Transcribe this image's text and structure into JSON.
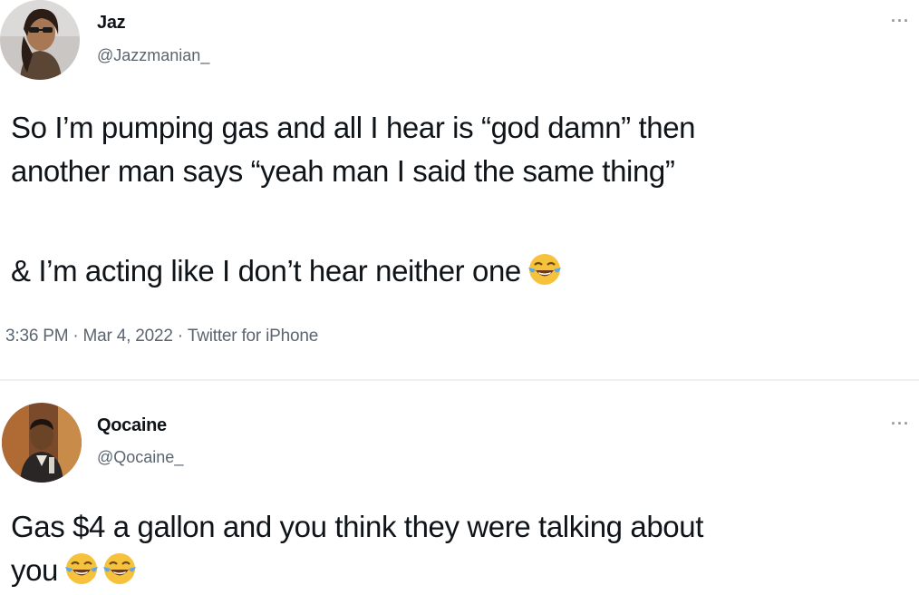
{
  "tweets": [
    {
      "display_name": "Jaz",
      "handle": "@Jazzmanian_",
      "text_lines": [
        "So I’m pumping gas and all I hear is “god damn” then",
        "another man says “yeah man I said the same thing”",
        "& I’m acting like I don’t hear neither one"
      ],
      "time": "3:36 PM",
      "date": "Mar 4, 2022",
      "source": "Twitter for iPhone",
      "more_label": "···"
    },
    {
      "display_name": "Qocaine",
      "handle": "@Qocaine_",
      "text_lines": [
        "Gas $4 a gallon and you think they were talking about",
        "you"
      ],
      "more_label": "···"
    }
  ],
  "icons": {
    "emoji": "face-with-tears-of-joy-icon",
    "more": "more-options-icon"
  },
  "colors": {
    "text": "#0f1419",
    "secondary": "#5b6570",
    "emoji_yellow": "#f7c23b",
    "tears": "#5aa9e6"
  }
}
